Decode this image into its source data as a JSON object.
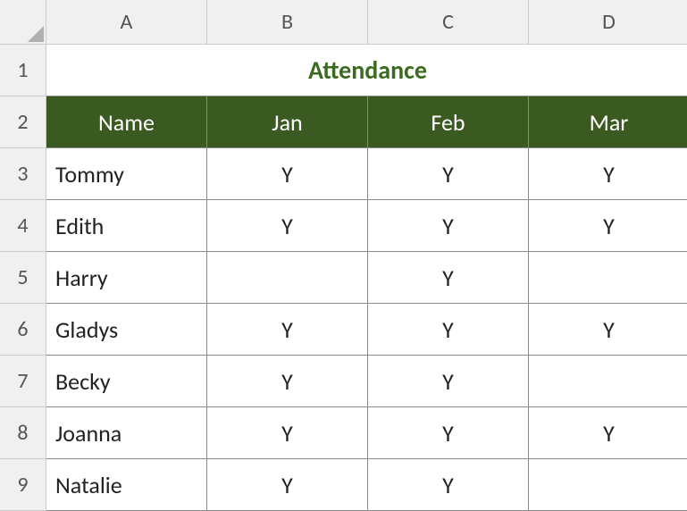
{
  "columns": [
    "A",
    "B",
    "C",
    "D"
  ],
  "rows": [
    "1",
    "2",
    "3",
    "4",
    "5",
    "6",
    "7",
    "8",
    "9"
  ],
  "title": "Attendance",
  "headers": {
    "name": "Name",
    "jan": "Jan",
    "feb": "Feb",
    "mar": "Mar"
  },
  "data": [
    {
      "name": "Tommy",
      "jan": "Y",
      "feb": "Y",
      "mar": "Y"
    },
    {
      "name": "Edith",
      "jan": "Y",
      "feb": "Y",
      "mar": "Y"
    },
    {
      "name": "Harry",
      "jan": "",
      "feb": "Y",
      "mar": ""
    },
    {
      "name": "Gladys",
      "jan": "Y",
      "feb": "Y",
      "mar": "Y"
    },
    {
      "name": "Becky",
      "jan": "Y",
      "feb": "Y",
      "mar": ""
    },
    {
      "name": "Joanna",
      "jan": "Y",
      "feb": "Y",
      "mar": "Y"
    },
    {
      "name": "Natalie",
      "jan": "Y",
      "feb": "Y",
      "mar": ""
    }
  ],
  "chart_data": {
    "type": "table",
    "title": "Attendance",
    "columns": [
      "Name",
      "Jan",
      "Feb",
      "Mar"
    ],
    "rows": [
      [
        "Tommy",
        "Y",
        "Y",
        "Y"
      ],
      [
        "Edith",
        "Y",
        "Y",
        "Y"
      ],
      [
        "Harry",
        "",
        "Y",
        ""
      ],
      [
        "Gladys",
        "Y",
        "Y",
        "Y"
      ],
      [
        "Becky",
        "Y",
        "Y",
        ""
      ],
      [
        "Joanna",
        "Y",
        "Y",
        "Y"
      ],
      [
        "Natalie",
        "Y",
        "Y",
        ""
      ]
    ]
  }
}
